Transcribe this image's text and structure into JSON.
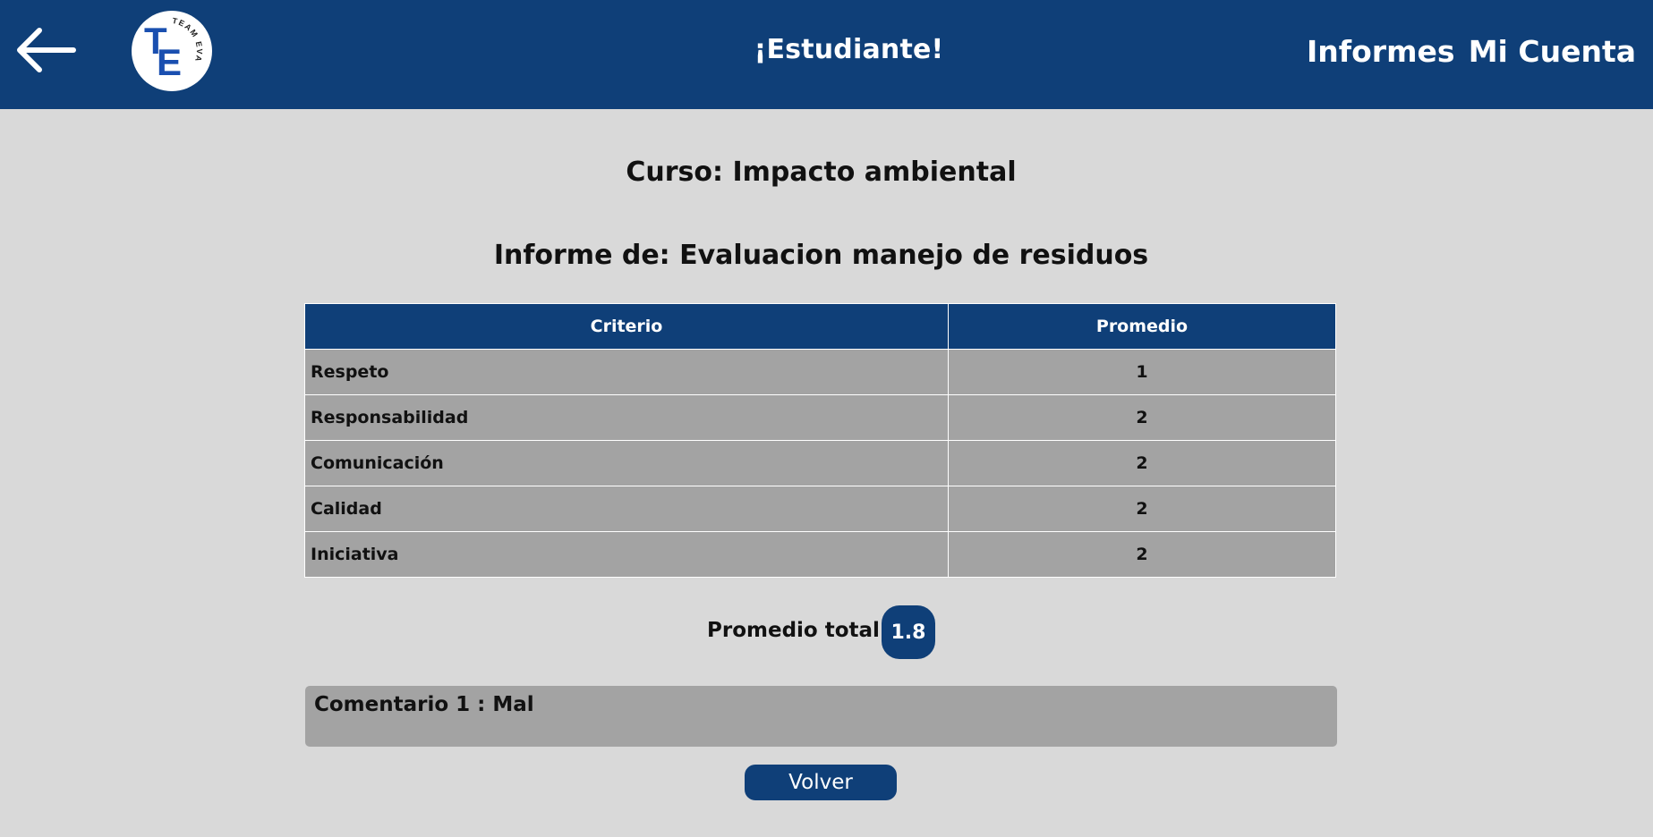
{
  "header": {
    "title": "¡Estudiante!",
    "nav": {
      "reports": "Informes",
      "account": "Mi Cuenta"
    },
    "back_icon": "arrow-left-icon",
    "logo": {
      "line1": "T",
      "line2": "E",
      "ring_text": "TEAM EVAL"
    }
  },
  "course": {
    "title": "Curso: Impacto ambiental"
  },
  "report": {
    "title": "Informe de: Evaluacion manejo de residuos",
    "columns": [
      "Criterio",
      "Promedio"
    ],
    "rows": [
      {
        "criterion": "Respeto",
        "average": "1"
      },
      {
        "criterion": "Responsabilidad",
        "average": "2"
      },
      {
        "criterion": "Comunicación",
        "average": "2"
      },
      {
        "criterion": "Calidad",
        "average": "2"
      },
      {
        "criterion": "Iniciativa",
        "average": "2"
      }
    ],
    "total_label": "Promedio total:",
    "total_value": "1.8"
  },
  "comments": [
    {
      "text": "Comentario 1 : Mal"
    }
  ],
  "actions": {
    "back_label": "Volver"
  },
  "colors": {
    "primary": "#0f3f78",
    "background": "#d9d9d9",
    "row": "#a3a3a3",
    "logo_letters": "#1a4fb0"
  }
}
